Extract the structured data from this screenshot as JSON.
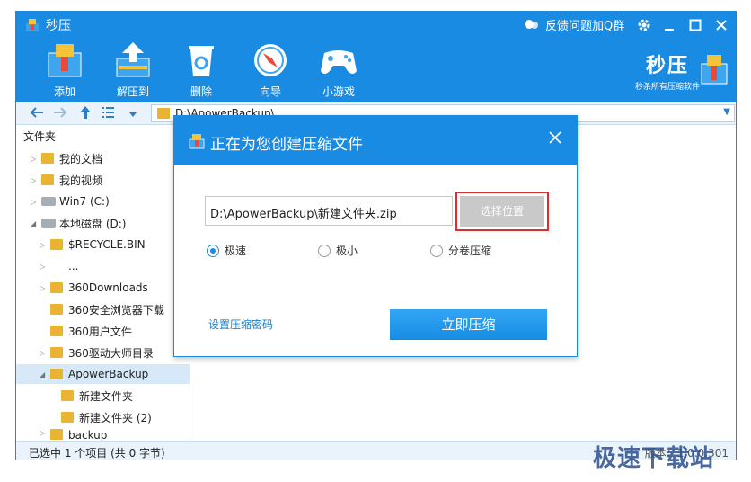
{
  "titlebar": {
    "title": "秒压",
    "feedback": "反馈问题加Q群"
  },
  "toolbar": {
    "tools": [
      {
        "label": "添加",
        "icon": "add-archive-icon"
      },
      {
        "label": "解压到",
        "icon": "extract-icon"
      },
      {
        "label": "删除",
        "icon": "trash-icon"
      },
      {
        "label": "向导",
        "icon": "compass-icon"
      },
      {
        "label": "小游戏",
        "icon": "gamepad-icon"
      }
    ],
    "brand_name": "秒压",
    "brand_sub": "秒杀所有压缩软件"
  },
  "address": {
    "path": "D:\\ApowerBackup\\"
  },
  "sidebar": {
    "header": "文件夹",
    "items": [
      {
        "label": "我的文档"
      },
      {
        "label": "我的视频"
      },
      {
        "label": "Win7 (C:)"
      },
      {
        "label": "本地磁盘 (D:)"
      },
      {
        "label": "$RECYCLE.BIN"
      },
      {
        "label": "..."
      },
      {
        "label": "360Downloads"
      },
      {
        "label": "360安全浏览器下载"
      },
      {
        "label": "360用户文件"
      },
      {
        "label": "360驱动大师目录"
      },
      {
        "label": "ApowerBackup"
      },
      {
        "label": "新建文件夹"
      },
      {
        "label": "新建文件夹 (2)"
      },
      {
        "label": "backup"
      }
    ]
  },
  "statusbar": {
    "left": "已选中 1 个项目 (共 0 字节)",
    "right": "版本：1.0.0.301"
  },
  "dialog": {
    "title": "正在为您创建压缩文件",
    "path_value": "D:\\ApowerBackup\\新建文件夹.zip",
    "choose_label": "选择位置",
    "options": [
      "极速",
      "极小",
      "分卷压缩"
    ],
    "selected_option": "极速",
    "password_link": "设置压缩密码",
    "compress_button": "立即压缩"
  },
  "watermark": "极速下载站",
  "colors": {
    "accent": "#1a8be3",
    "highlight_border": "#d9302f",
    "button_disabled": "#c9c9c9"
  }
}
